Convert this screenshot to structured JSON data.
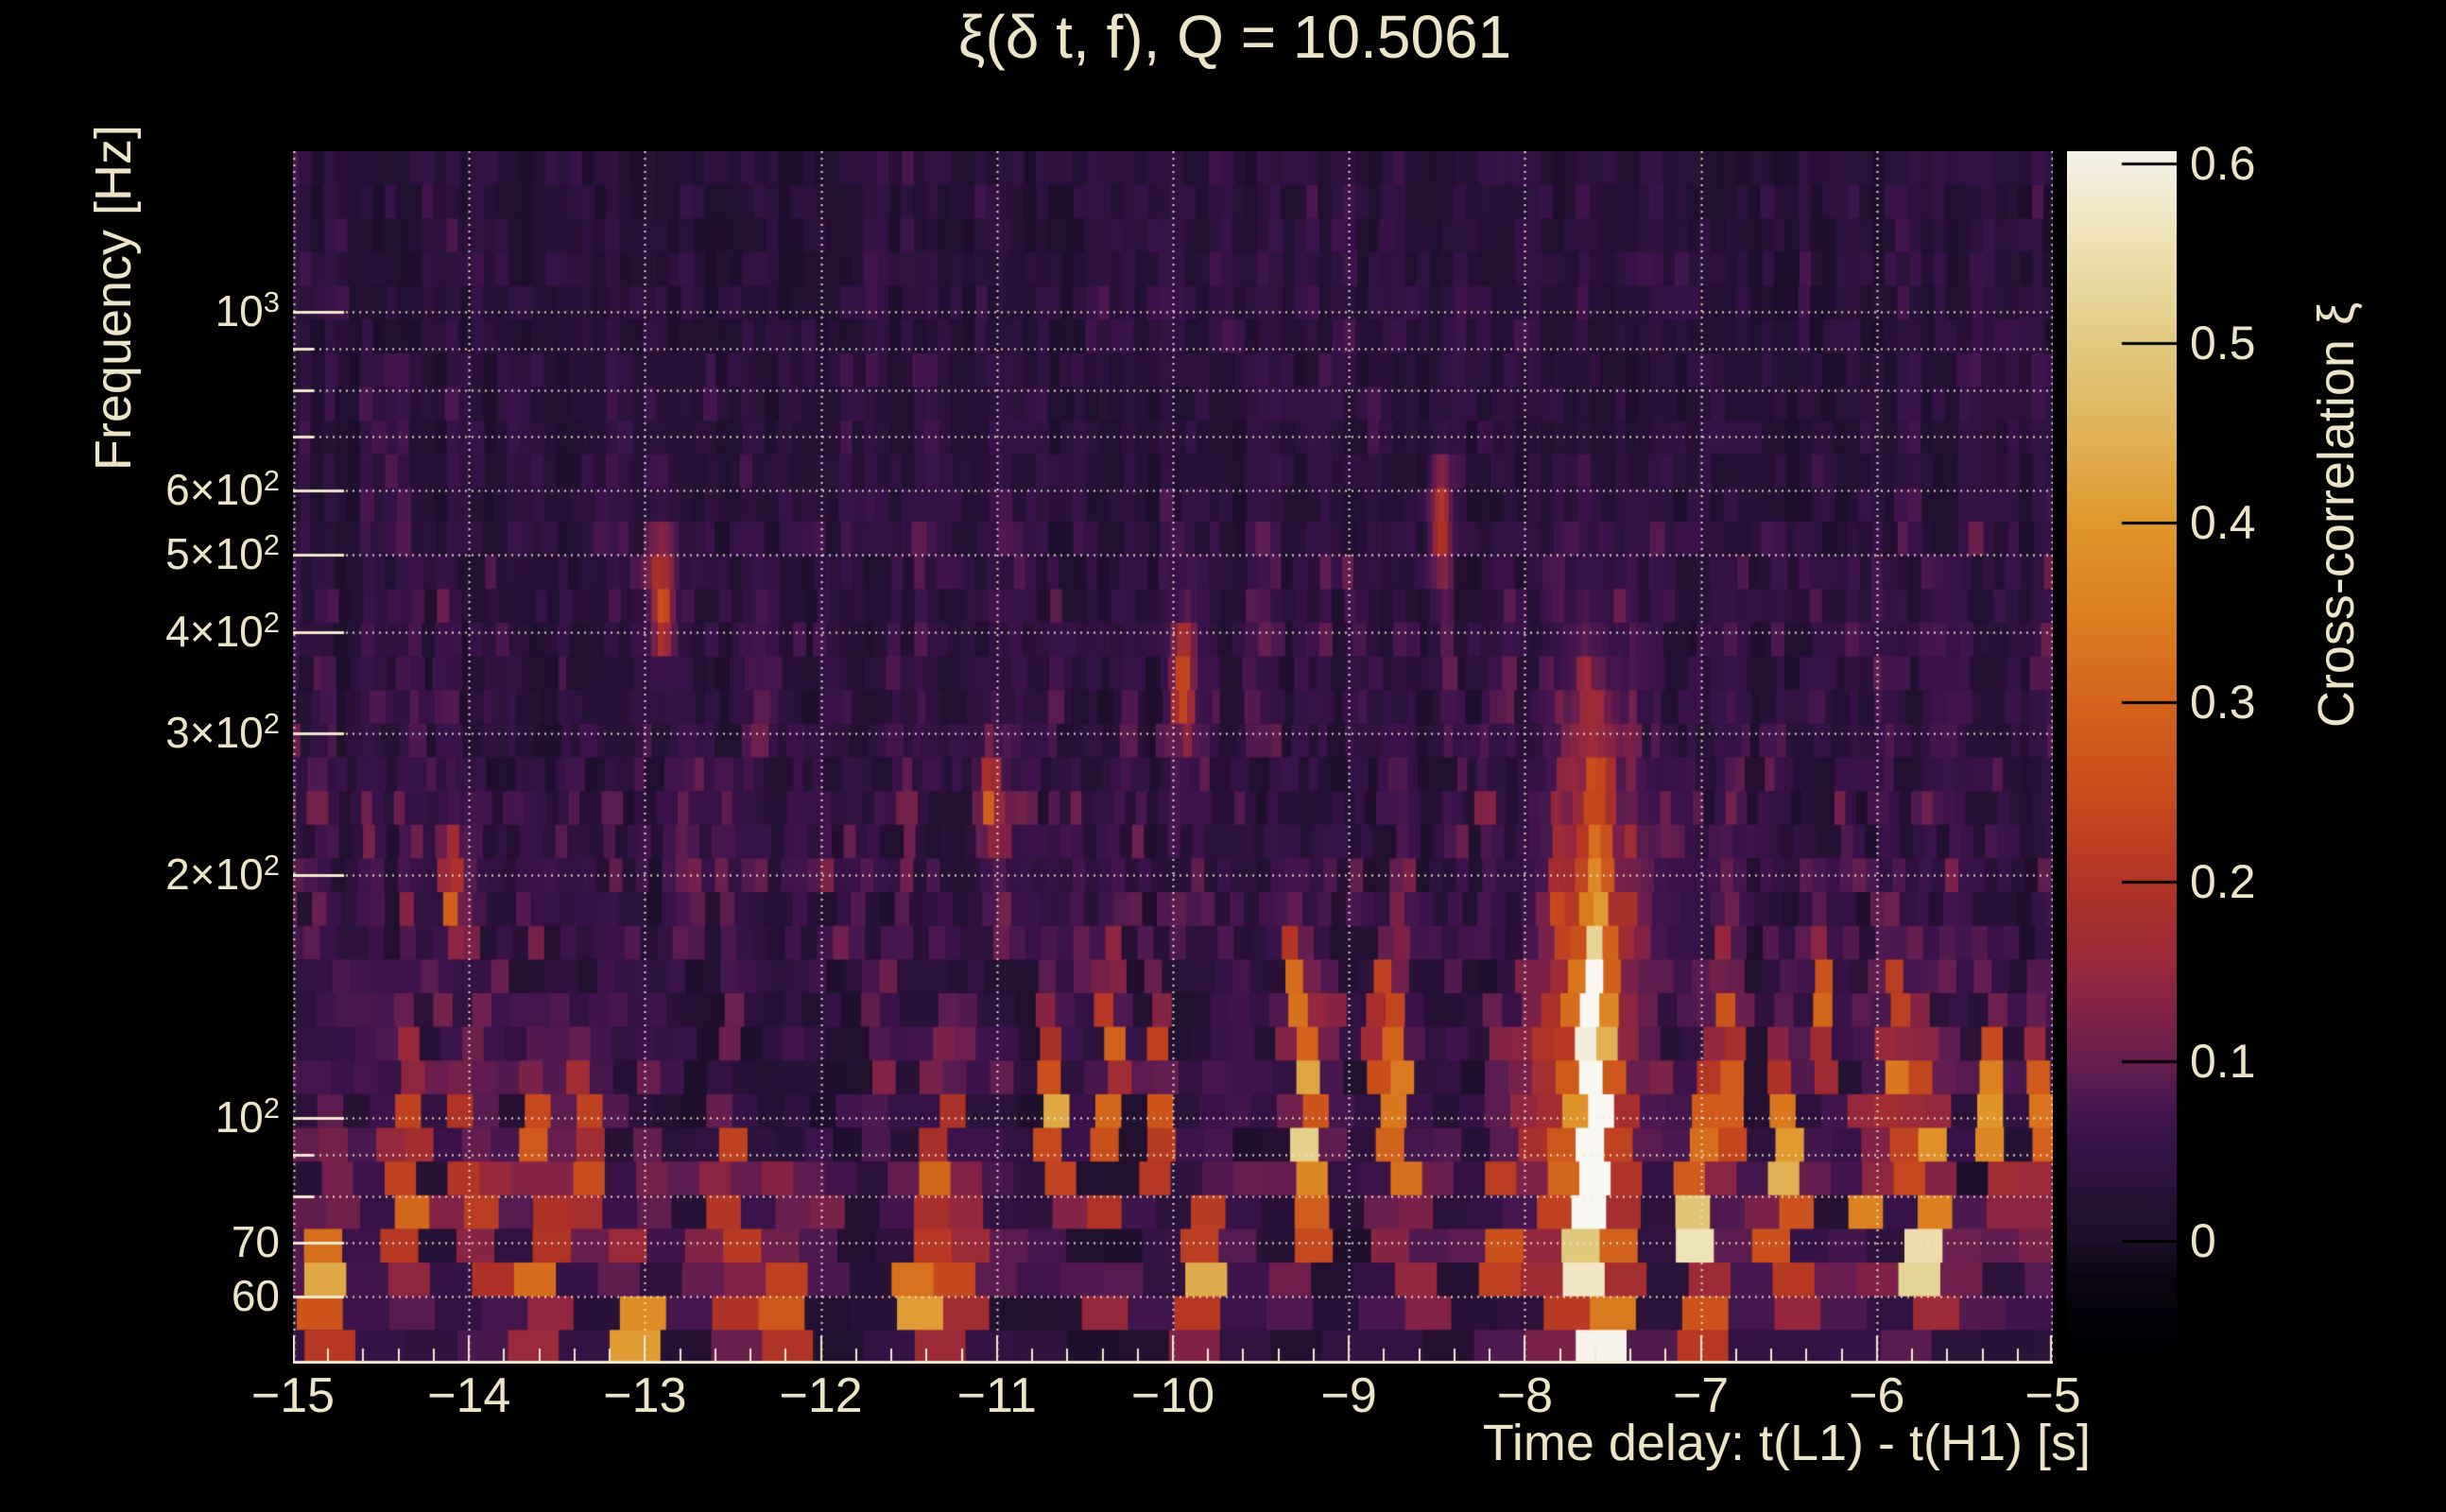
{
  "figure": {
    "background": "#000000",
    "text_color": "#ece4c6",
    "grid_color": "#f0e8cd"
  },
  "chart_data": {
    "type": "heatmap",
    "title": "ξ(δ t, f), Q = 10.5061",
    "q_value": 10.5061,
    "xlabel": "Time delay: t(L1) - t(H1) [s]",
    "ylabel": "Frequency [Hz]",
    "colorbar_label": "Cross-correlation ξ",
    "x_axis": {
      "min": -15,
      "max": -5,
      "scale": "linear",
      "minor_step": 0.2,
      "ticks": [
        {
          "t": -15,
          "label": "−15"
        },
        {
          "t": -14,
          "label": "−14"
        },
        {
          "t": -13,
          "label": "−13"
        },
        {
          "t": -12,
          "label": "−12"
        },
        {
          "t": -11,
          "label": "−11"
        },
        {
          "t": -10,
          "label": "−10"
        },
        {
          "t": -9,
          "label": "−9"
        },
        {
          "t": -8,
          "label": "−8"
        },
        {
          "t": -7,
          "label": "−7"
        },
        {
          "t": -6,
          "label": "−6"
        },
        {
          "t": -5,
          "label": "−5"
        }
      ]
    },
    "y_axis": {
      "min": 49.6,
      "max": 1582,
      "scale": "log",
      "ticks": [
        {
          "f": 1000,
          "base": "10",
          "exp": "3"
        },
        {
          "f": 600,
          "base": "6×10",
          "exp": "2"
        },
        {
          "f": 500,
          "base": "5×10",
          "exp": "2"
        },
        {
          "f": 400,
          "base": "4×10",
          "exp": "2"
        },
        {
          "f": 300,
          "base": "3×10",
          "exp": "2"
        },
        {
          "f": 200,
          "base": "2×10",
          "exp": "2"
        },
        {
          "f": 100,
          "base": "10",
          "exp": "2"
        },
        {
          "f": 70,
          "base": "70",
          "exp": ""
        },
        {
          "f": 60,
          "base": "60",
          "exp": ""
        }
      ],
      "gridline_freqs": [
        60,
        70,
        80,
        90,
        100,
        200,
        300,
        400,
        500,
        600,
        700,
        800,
        900,
        1000
      ],
      "long_tick_freqs": [
        60,
        70,
        100,
        200,
        300,
        400,
        500,
        600,
        1000
      ]
    },
    "colorbar": {
      "vmin": -0.065,
      "vmax": 0.607,
      "ticks": [
        {
          "v": 0.6,
          "label": "0.6"
        },
        {
          "v": 0.5,
          "label": "0.5"
        },
        {
          "v": 0.4,
          "label": "0.4"
        },
        {
          "v": 0.3,
          "label": "0.3"
        },
        {
          "v": 0.2,
          "label": "0.2"
        },
        {
          "v": 0.1,
          "label": "0.1"
        },
        {
          "v": 0.0,
          "label": "0"
        }
      ]
    },
    "colormap_stops": [
      {
        "v": -0.065,
        "c": "#000002"
      },
      {
        "v": -0.02,
        "c": "#0b0513"
      },
      {
        "v": 0.0,
        "c": "#1c0f29"
      },
      {
        "v": 0.03,
        "c": "#2a1239"
      },
      {
        "v": 0.06,
        "c": "#3a134b"
      },
      {
        "v": 0.08,
        "c": "#4c1950"
      },
      {
        "v": 0.1,
        "c": "#671e4f"
      },
      {
        "v": 0.13,
        "c": "#832347"
      },
      {
        "v": 0.16,
        "c": "#9d2a38"
      },
      {
        "v": 0.2,
        "c": "#b23426"
      },
      {
        "v": 0.25,
        "c": "#c94d1d"
      },
      {
        "v": 0.3,
        "c": "#d4641c"
      },
      {
        "v": 0.35,
        "c": "#dc7f20"
      },
      {
        "v": 0.4,
        "c": "#e0982e"
      },
      {
        "v": 0.45,
        "c": "#e0b357"
      },
      {
        "v": 0.5,
        "c": "#e1ca80"
      },
      {
        "v": 0.55,
        "c": "#eddfae"
      },
      {
        "v": 0.607,
        "c": "#f5f2e9"
      },
      {
        "v": 0.66,
        "c": "#ffffff"
      }
    ],
    "noise_seed": 7,
    "features": [
      {
        "t": -7.6,
        "f": 75,
        "xi": 0.63,
        "dt": 0.05,
        "dlf": 0.16
      },
      {
        "t": -7.6,
        "f": 130,
        "xi": 0.25,
        "dt": 0.05,
        "dlf": 0.22
      },
      {
        "t": -7.63,
        "f": 85,
        "xi": 0.3,
        "dt": 0.18,
        "dlf": 0.35
      },
      {
        "t": -7.05,
        "f": 62,
        "xi": 0.45,
        "dt": 0.05,
        "dlf": 0.1
      },
      {
        "t": -6.97,
        "f": 92,
        "xi": 0.28,
        "dt": 0.04,
        "dlf": 0.1
      },
      {
        "t": -6.85,
        "f": 115,
        "xi": 0.33,
        "dt": 0.04,
        "dlf": 0.1
      },
      {
        "t": -6.55,
        "f": 70,
        "xi": 0.4,
        "dt": 0.05,
        "dlf": 0.12
      },
      {
        "t": -6.5,
        "f": 102,
        "xi": 0.26,
        "dt": 0.04,
        "dlf": 0.08
      },
      {
        "t": -6.3,
        "f": 145,
        "xi": 0.22,
        "dt": 0.04,
        "dlf": 0.07
      },
      {
        "t": -6.05,
        "f": 75,
        "xi": 0.25,
        "dt": 0.04,
        "dlf": 0.09
      },
      {
        "t": -5.9,
        "f": 115,
        "xi": 0.28,
        "dt": 0.04,
        "dlf": 0.09
      },
      {
        "t": -5.74,
        "f": 63,
        "xi": 0.46,
        "dt": 0.05,
        "dlf": 0.13
      },
      {
        "t": -5.7,
        "f": 92,
        "xi": 0.27,
        "dt": 0.04,
        "dlf": 0.08
      },
      {
        "t": -5.33,
        "f": 100,
        "xi": 0.42,
        "dt": 0.04,
        "dlf": 0.07
      },
      {
        "t": -5.05,
        "f": 100,
        "xi": 0.27,
        "dt": 0.04,
        "dlf": 0.09
      },
      {
        "t": -8.15,
        "f": 70,
        "xi": 0.24,
        "dt": 0.04,
        "dlf": 0.08
      },
      {
        "t": -8.48,
        "f": 550,
        "xi": 0.2,
        "dt": 0.04,
        "dlf": 0.05
      },
      {
        "t": -8.7,
        "f": 95,
        "xi": 0.34,
        "dt": 0.05,
        "dlf": 0.12
      },
      {
        "t": -8.8,
        "f": 125,
        "xi": 0.26,
        "dt": 0.04,
        "dlf": 0.08
      },
      {
        "t": -9.25,
        "f": 95,
        "xi": 0.44,
        "dt": 0.05,
        "dlf": 0.1
      },
      {
        "t": -9.32,
        "f": 150,
        "xi": 0.22,
        "dt": 0.04,
        "dlf": 0.06
      },
      {
        "t": -9.8,
        "f": 60,
        "xi": 0.38,
        "dt": 0.05,
        "dlf": 0.08
      },
      {
        "t": -9.95,
        "f": 350,
        "xi": 0.21,
        "dt": 0.04,
        "dlf": 0.05
      },
      {
        "t": -10.1,
        "f": 100,
        "xi": 0.3,
        "dt": 0.04,
        "dlf": 0.08
      },
      {
        "t": -10.36,
        "f": 120,
        "xi": 0.31,
        "dt": 0.04,
        "dlf": 0.08
      },
      {
        "t": -10.66,
        "f": 105,
        "xi": 0.34,
        "dt": 0.04,
        "dlf": 0.08
      },
      {
        "t": -11.05,
        "f": 250,
        "xi": 0.18,
        "dt": 0.04,
        "dlf": 0.05
      },
      {
        "t": -11.3,
        "f": 78,
        "xi": 0.4,
        "dt": 0.05,
        "dlf": 0.11
      },
      {
        "t": -11.45,
        "f": 57,
        "xi": 0.34,
        "dt": 0.05,
        "dlf": 0.07
      },
      {
        "t": -12.2,
        "f": 58,
        "xi": 0.26,
        "dt": 0.04,
        "dlf": 0.06
      },
      {
        "t": -12.5,
        "f": 72,
        "xi": 0.35,
        "dt": 0.05,
        "dlf": 0.09
      },
      {
        "t": -12.9,
        "f": 440,
        "xi": 0.21,
        "dt": 0.04,
        "dlf": 0.05
      },
      {
        "t": -13.05,
        "f": 56,
        "xi": 0.42,
        "dt": 0.05,
        "dlf": 0.07
      },
      {
        "t": -13.35,
        "f": 95,
        "xi": 0.25,
        "dt": 0.04,
        "dlf": 0.07
      },
      {
        "t": -13.6,
        "f": 75,
        "xi": 0.42,
        "dt": 0.05,
        "dlf": 0.12
      },
      {
        "t": -13.9,
        "f": 70,
        "xi": 0.29,
        "dt": 0.04,
        "dlf": 0.08
      },
      {
        "t": -14.05,
        "f": 90,
        "xi": 0.23,
        "dt": 0.04,
        "dlf": 0.07
      },
      {
        "t": -14.1,
        "f": 190,
        "xi": 0.28,
        "dt": 0.035,
        "dlf": 0.06
      },
      {
        "t": -14.35,
        "f": 80,
        "xi": 0.27,
        "dt": 0.04,
        "dlf": 0.08
      },
      {
        "t": -14.8,
        "f": 65,
        "xi": 0.32,
        "dt": 0.05,
        "dlf": 0.09
      }
    ]
  }
}
